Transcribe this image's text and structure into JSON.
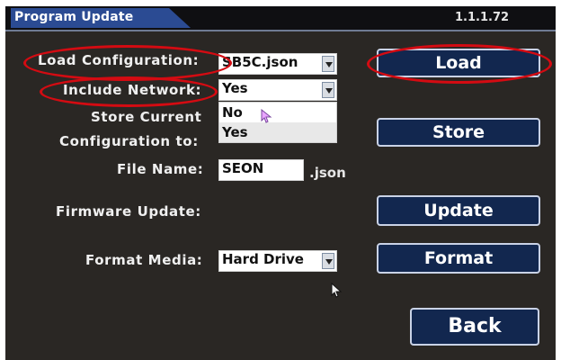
{
  "window": {
    "title": "Program Update",
    "version": "1.1.1.72"
  },
  "load_configuration": {
    "label": "Load Configuration:",
    "value": "SB5C.json",
    "button": "Load"
  },
  "include_network": {
    "label": "Include Network:",
    "value": "Yes",
    "options": [
      "No",
      "Yes"
    ]
  },
  "store_current": {
    "label_line1": "Store Current",
    "label_line2": "Configuration to:",
    "button": "Store"
  },
  "file_name": {
    "label": "File Name:",
    "value": "SEON",
    "suffix": ".json"
  },
  "firmware_update": {
    "label": "Firmware Update:",
    "button": "Update"
  },
  "format_media": {
    "label": "Format Media:",
    "value": "Hard Drive",
    "button": "Format"
  },
  "back": {
    "label": "Back"
  },
  "colors": {
    "background": "#2a2724",
    "tab": "#2b4b93",
    "button": "#12274f",
    "highlight_ellipse": "#d40b12"
  }
}
